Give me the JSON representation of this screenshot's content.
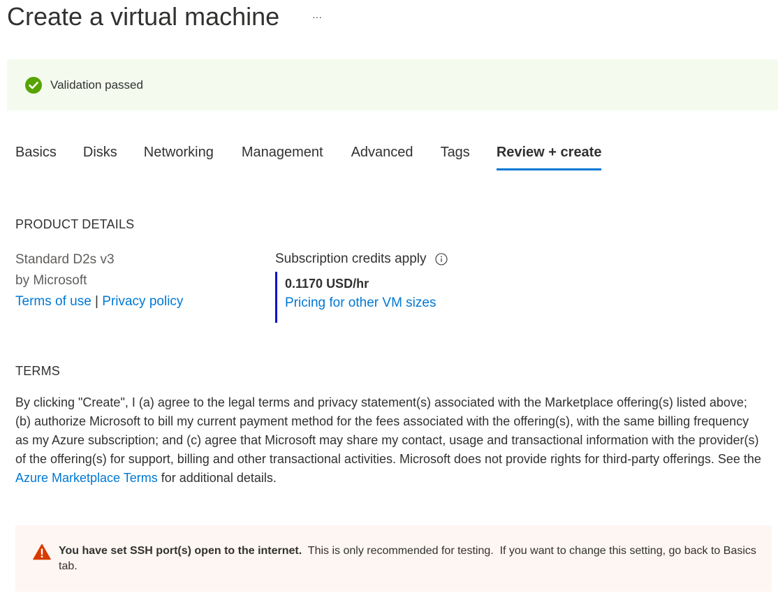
{
  "header": {
    "title": "Create a virtual machine",
    "more_label": "···"
  },
  "validation": {
    "icon": "checkmark-circle-icon",
    "message": "Validation passed",
    "color": "#57a300"
  },
  "tabs": [
    {
      "label": "Basics",
      "active": false
    },
    {
      "label": "Disks",
      "active": false
    },
    {
      "label": "Networking",
      "active": false
    },
    {
      "label": "Management",
      "active": false
    },
    {
      "label": "Advanced",
      "active": false
    },
    {
      "label": "Tags",
      "active": false
    },
    {
      "label": "Review + create",
      "active": true
    }
  ],
  "product_details": {
    "heading": "PRODUCT DETAILS",
    "product_name": "Standard D2s v3",
    "publisher": "by Microsoft",
    "terms_link": "Terms of use",
    "separator": "|",
    "privacy_link": "Privacy policy",
    "credits_label": "Subscription credits apply",
    "price": "0.1170 USD/hr",
    "pricing_link": "Pricing for other VM sizes"
  },
  "terms": {
    "heading": "TERMS",
    "body_before_link": "By clicking \"Create\", I (a) agree to the legal terms and privacy statement(s) associated with the Marketplace offering(s) listed above; (b) authorize Microsoft to bill my current payment method for the fees associated with the offering(s), with the same billing frequency as my Azure subscription; and (c) agree that Microsoft may share my contact, usage and transactional information with the provider(s) of the offering(s) for support, billing and other transactional activities. Microsoft does not provide rights for third-party offerings. See the ",
    "link": "Azure Marketplace Terms",
    "body_after_link": " for additional details."
  },
  "warning": {
    "icon": "warning-triangle-icon",
    "bold": "You have set SSH port(s) open to the internet.",
    "message": "  This is only recommended for testing.  If you want to change this setting, go back to Basics tab.",
    "color": "#d83b01"
  },
  "colors": {
    "accent": "#0078d4",
    "price_bar": "#0013c8",
    "success_bg": "#f4fbee",
    "warning_bg": "#fdf6f2"
  }
}
